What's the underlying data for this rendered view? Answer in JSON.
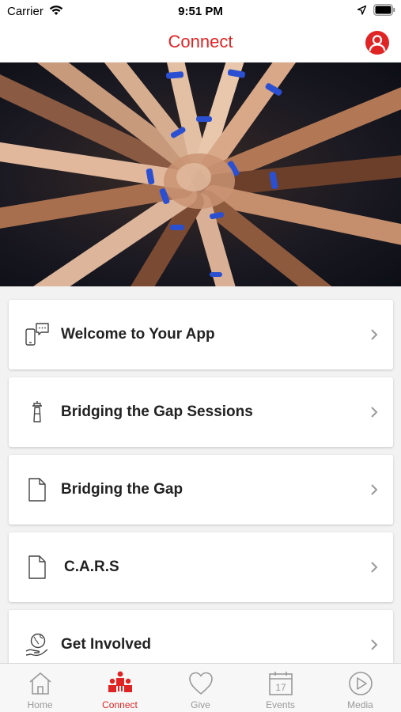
{
  "status_bar": {
    "carrier": "Carrier",
    "time": "9:51 PM"
  },
  "nav": {
    "title": "Connect"
  },
  "colors": {
    "accent": "#e02424",
    "inactive": "#999999"
  },
  "cards": [
    {
      "label": "Welcome to Your App",
      "icon": "chat-phone-icon"
    },
    {
      "label": "Bridging the Gap Sessions",
      "icon": "lighthouse-icon"
    },
    {
      "label": "Bridging the Gap",
      "icon": "document-icon"
    },
    {
      "label": "C.A.R.S",
      "icon": "document-icon"
    },
    {
      "label": "Get Involved",
      "icon": "globe-hand-icon"
    }
  ],
  "tabs": [
    {
      "label": "Home",
      "icon": "home-icon",
      "active": false
    },
    {
      "label": "Connect",
      "icon": "people-icon",
      "active": true
    },
    {
      "label": "Give",
      "icon": "heart-icon",
      "active": false
    },
    {
      "label": "Events",
      "icon": "calendar-icon",
      "active": false,
      "calendar_day": "17"
    },
    {
      "label": "Media",
      "icon": "play-icon",
      "active": false
    }
  ]
}
